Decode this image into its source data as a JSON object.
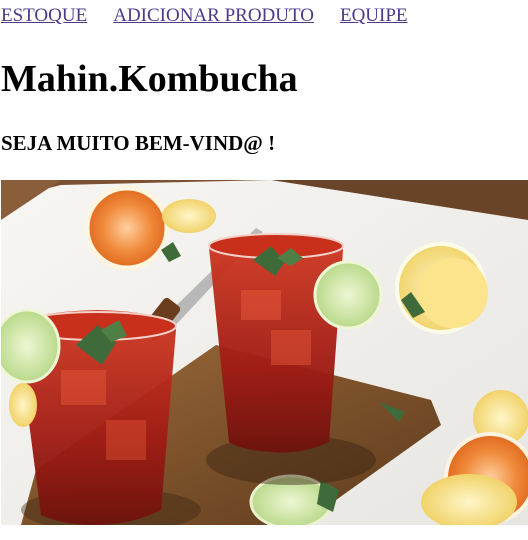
{
  "nav": {
    "items": [
      {
        "label": "ESTOQUE"
      },
      {
        "label": "ADICIONAR PRODUTO"
      },
      {
        "label": "EQUIPE"
      }
    ]
  },
  "header": {
    "title": "Mahin.Kombucha",
    "welcome": "SEJA MUITO BEM-VIND@ !"
  },
  "hero": {
    "image_subject": "two glasses of iced kombucha with mint and lime on a wooden board with citrus slices",
    "colors": {
      "drink": "#b8251a",
      "board": "#7a4a25",
      "table": "#f4f2ee",
      "orange": "#f08a3a",
      "lemon": "#f4d876",
      "lime": "#c9e39a",
      "mint": "#3f6b3a"
    }
  },
  "colors": {
    "link": "#4b3a8c"
  }
}
